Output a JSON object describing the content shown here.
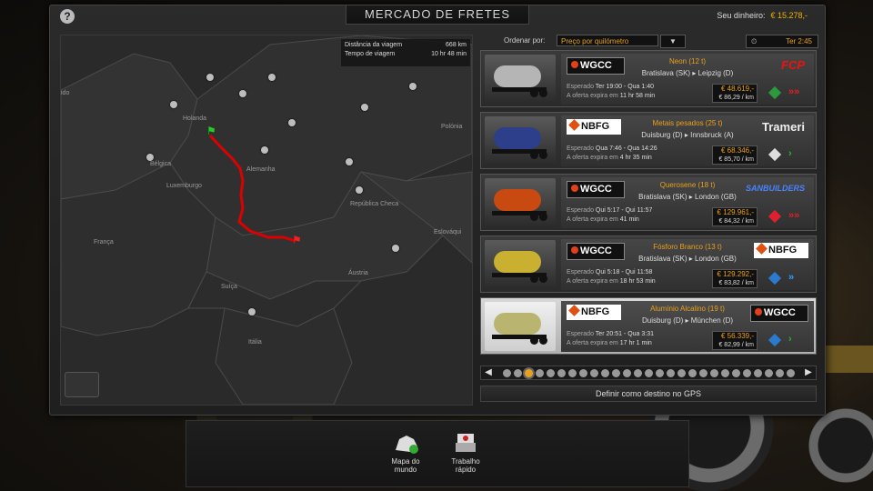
{
  "header": {
    "help": "?",
    "title": "MERCADO DE FRETES",
    "money_label": "Seu dinheiro:",
    "money_value": "€ 15.278,-"
  },
  "map": {
    "distance_label": "Distância da viagem",
    "distance_value": "668 km",
    "time_label": "Tempo de viagem",
    "time_value": "10 hr 48 min",
    "countries": [
      "Holanda",
      "Bélgica",
      "Luxemburgo",
      "Alemanha",
      "França",
      "Suíça",
      "Itália",
      "Áustria",
      "República Checa",
      "Eslováqui",
      "Polónia",
      "ido"
    ]
  },
  "sort": {
    "label": "Ordenar por:",
    "value": "Preço por quilómetro",
    "dropdown": "▼"
  },
  "clock": {
    "icon": "clock-icon",
    "time": "Ter 2:45"
  },
  "offers": [
    {
      "from_logo": "WGCC",
      "to_logo": "FCP",
      "cargo": "Neon (12 t)",
      "origin": "Bratislava (SK)",
      "destination": "Leipzig (D)",
      "sched_label": "Esperado",
      "sched": "Ter 19:00 - Qua 1:40",
      "expire_label": "A oferta expira em",
      "expire": "11 hr 58 min",
      "price": "€ 48.619,-",
      "per_km": "€ 86,29 / km",
      "tank": "#b5b5b5",
      "diamond": "#2a9a3a",
      "arrows": "»»",
      "arrow_color": "#e02020"
    },
    {
      "from_logo": "NBFG",
      "to_logo": "Trameri",
      "cargo": "Metais pesados (25 t)",
      "origin": "Duisburg (D)",
      "destination": "Innsbruck (A)",
      "sched_label": "Esperado",
      "sched": "Qua 7:46 - Qua 14:26",
      "expire_label": "A oferta expira em",
      "expire": "4 hr 35 min",
      "price": "€ 68.346,-",
      "per_km": "€ 85,70 / km",
      "tank": "#2d3f8a",
      "diamond": "#dddddd",
      "arrows": "›",
      "arrow_color": "#30b030"
    },
    {
      "from_logo": "WGCC",
      "to_logo": "SANBUILDERS",
      "cargo": "Querosene (18 t)",
      "origin": "Bratislava (SK)",
      "destination": "London (GB)",
      "sched_label": "Esperado",
      "sched": "Qui 5:17 - Qui 11:57",
      "expire_label": "A oferta expira em",
      "expire": "41 min",
      "price": "€ 129.961,-",
      "per_km": "€ 84,32 / km",
      "tank": "#c84a10",
      "diamond": "#e02030",
      "arrows": "»»",
      "arrow_color": "#e02020"
    },
    {
      "from_logo": "WGCC",
      "to_logo": "NBFG",
      "cargo": "Fósforo Branco (13 t)",
      "origin": "Bratislava (SK)",
      "destination": "London (GB)",
      "sched_label": "Esperado",
      "sched": "Qui 5:18 - Qui 11:58",
      "expire_label": "A oferta expira em",
      "expire": "18 hr 53 min",
      "price": "€ 129.292,-",
      "per_km": "€ 83,82 / km",
      "tank": "#c9b030",
      "diamond": "#2a7ad0",
      "arrows": "»",
      "arrow_color": "#30a0ff"
    },
    {
      "from_logo": "NBFG",
      "to_logo": "WGCC",
      "cargo": "Alumínio Alcalino (19 t)",
      "origin": "Duisburg (D)",
      "destination": "München (D)",
      "sched_label": "Esperado",
      "sched": "Ter 20:51 - Qua 3:31",
      "expire_label": "A oferta expira em",
      "expire": "17 hr 1 min",
      "price": "€ 56.339,-",
      "per_km": "€ 82,99 / km",
      "tank": "#b9b570",
      "diamond": "#2a7ad0",
      "arrows": "›",
      "arrow_color": "#30b030"
    }
  ],
  "pager": {
    "prev": "◀",
    "next": "▶",
    "pages": 27,
    "active": 2
  },
  "gps_button": "Definir como destino no GPS",
  "bottom": {
    "world_map_1": "Mapa do",
    "world_map_2": "mundo",
    "quick_job_1": "Trabalho",
    "quick_job_2": "rápido"
  }
}
